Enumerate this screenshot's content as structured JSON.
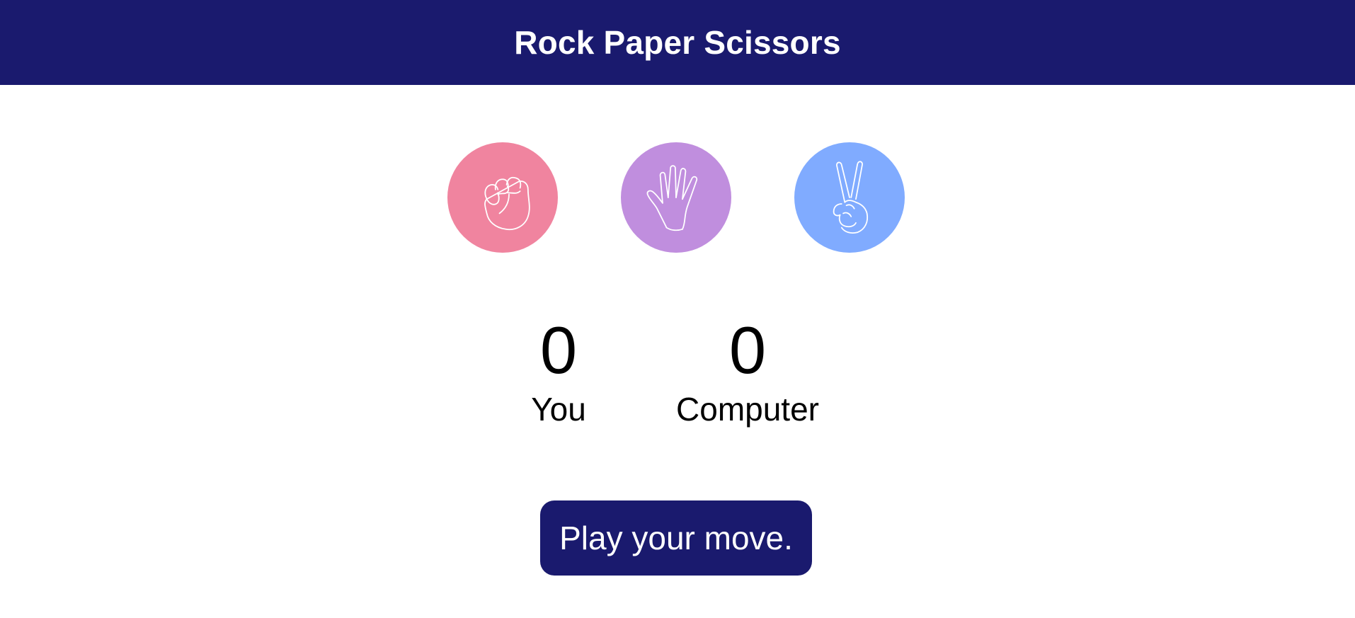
{
  "header": {
    "title": "Rock Paper Scissors"
  },
  "choices": [
    {
      "name": "rock",
      "icon": "fist-icon",
      "color": "#f0849f"
    },
    {
      "name": "paper",
      "icon": "open-hand-icon",
      "color": "#c08ede"
    },
    {
      "name": "scissors",
      "icon": "peace-sign-icon",
      "color": "#80abff"
    }
  ],
  "scores": {
    "you": {
      "value": "0",
      "label": "You"
    },
    "computer": {
      "value": "0",
      "label": "Computer"
    }
  },
  "status": {
    "message": "Play your move."
  },
  "colors": {
    "primary": "#1a1a6e",
    "text": "#000000",
    "background": "#ffffff"
  }
}
